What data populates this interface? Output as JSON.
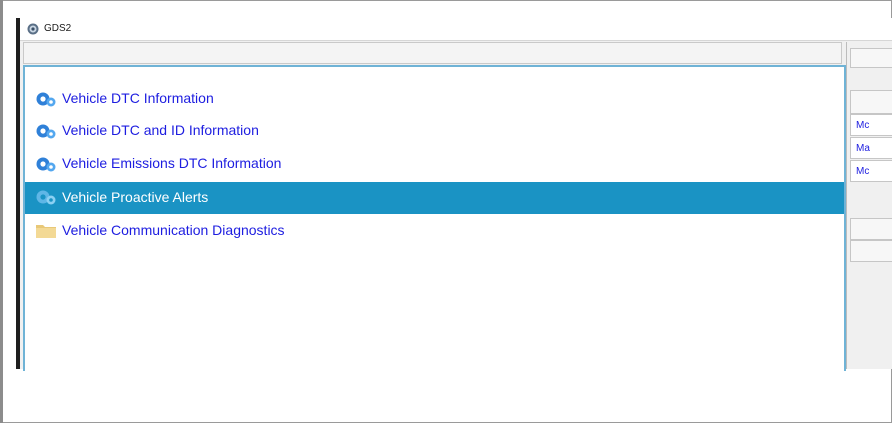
{
  "window": {
    "title": "GDS2",
    "icon": "gds2-app-icon"
  },
  "list": {
    "items": [
      {
        "label": "Vehicle DTC Information",
        "icon": "gear-icon",
        "selected": false
      },
      {
        "label": "Vehicle DTC and ID Information",
        "icon": "gear-icon",
        "selected": false
      },
      {
        "label": "Vehicle Emissions DTC Information",
        "icon": "gear-icon",
        "selected": false
      },
      {
        "label": "Vehicle Proactive Alerts",
        "icon": "gear-icon",
        "selected": true
      },
      {
        "label": "Vehicle Communication Diagnostics",
        "icon": "folder-icon",
        "selected": false
      }
    ]
  },
  "right_panel": {
    "cells": [
      "Mc",
      "Ma",
      "Mc"
    ]
  },
  "colors": {
    "selection": "#1a93c4",
    "link_text": "#1d1de0",
    "list_border": "#6fb3d6"
  }
}
